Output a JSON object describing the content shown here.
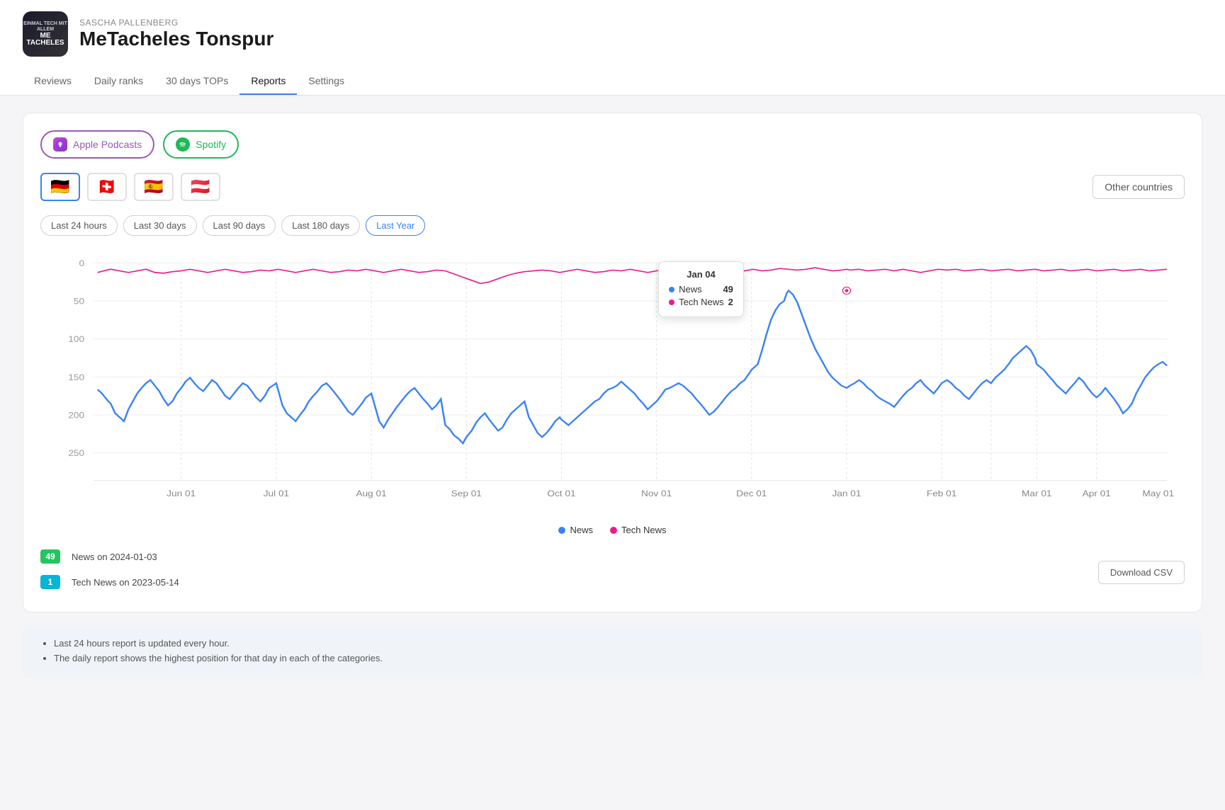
{
  "header": {
    "author": "SASCHA PALLENBERG",
    "podcast_name": "MeTacheles Tonspur",
    "avatar_text_top": "EINMAL TECH MIT ALLEM",
    "avatar_logo": "ME TACHELES"
  },
  "nav": {
    "items": [
      {
        "label": "Reviews",
        "active": false
      },
      {
        "label": "Daily ranks",
        "active": false
      },
      {
        "label": "30 days TOPs",
        "active": false
      },
      {
        "label": "Reports",
        "active": true
      },
      {
        "label": "Settings",
        "active": false
      }
    ]
  },
  "platforms": {
    "apple_label": "Apple Podcasts",
    "spotify_label": "Spotify"
  },
  "countries": {
    "flags": [
      "🇩🇪",
      "🇨🇭",
      "🇪🇸",
      "🇦🇹"
    ],
    "active_index": 0,
    "other_label": "Other countries"
  },
  "time_periods": {
    "buttons": [
      "Last 24 hours",
      "Last 30 days",
      "Last 90 days",
      "Last 180 days",
      "Last Year"
    ],
    "active": "Last Year"
  },
  "chart": {
    "y_labels": [
      "0",
      "50",
      "100",
      "150",
      "200",
      "250"
    ],
    "x_labels": [
      "Jun 01",
      "Jul 01",
      "Aug 01",
      "Sep 01",
      "Oct 01",
      "Nov 01",
      "Dec 01",
      "Jan 01",
      "Feb 01",
      "Mar 01",
      "Apr 01",
      "May 01"
    ],
    "tooltip": {
      "date": "Jan 04",
      "news_label": "News",
      "news_value": "49",
      "tech_news_label": "Tech News",
      "tech_news_value": "2"
    }
  },
  "legend": {
    "news_label": "News",
    "tech_news_label": "Tech News"
  },
  "stats": {
    "news_badge": "49",
    "news_text": "News on 2024-01-03",
    "tech_badge": "1",
    "tech_text": "Tech News on 2023-05-14",
    "download_label": "Download CSV"
  },
  "info": {
    "bullets": [
      "Last 24 hours report is updated every hour.",
      "The daily report shows the highest position for that day in each of the categories."
    ]
  }
}
